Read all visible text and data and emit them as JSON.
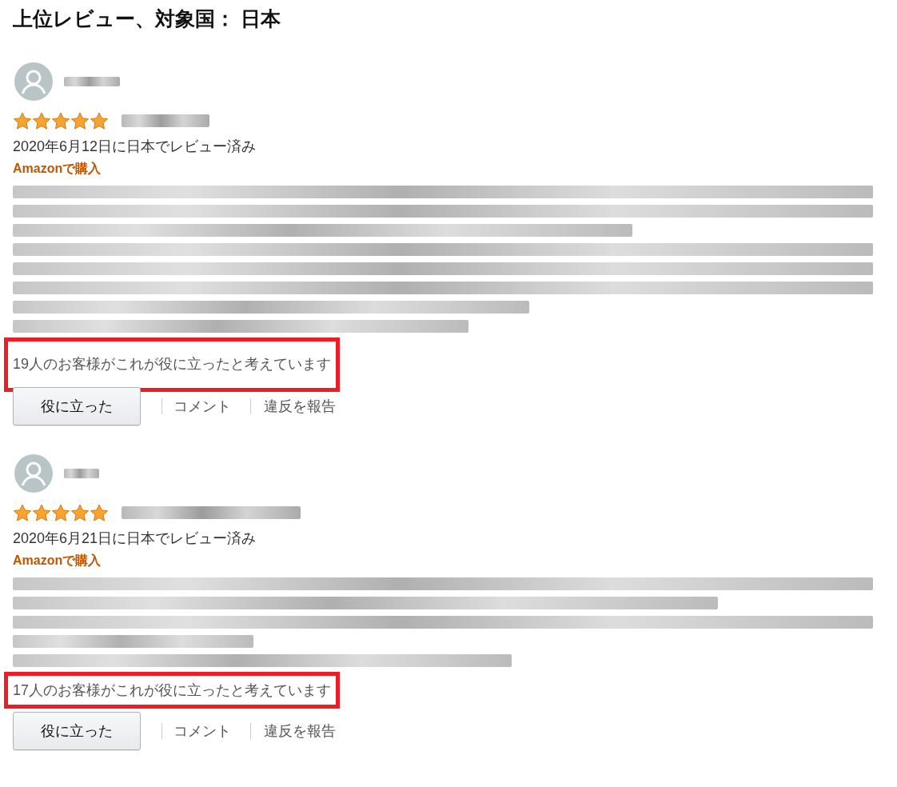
{
  "heading": "上位レビュー、対象国： 日本",
  "reviews": [
    {
      "stars": 5,
      "date": "2020年6月12日に日本でレビュー済み",
      "purchase": "Amazonで購入",
      "helpful": "19人のお客様がこれが役に立ったと考えています",
      "highlighted": true,
      "actions": [
        "役に立った",
        "コメント",
        "違反を報告"
      ]
    },
    {
      "stars": 5,
      "date": "2020年6月21日に日本でレビュー済み",
      "purchase": "Amazonで購入",
      "helpful": "17人のお客様がこれが役に立ったと考えています",
      "highlighted": true,
      "actions": [
        "役に立った",
        "コメント",
        "違反を報告"
      ]
    }
  ]
}
